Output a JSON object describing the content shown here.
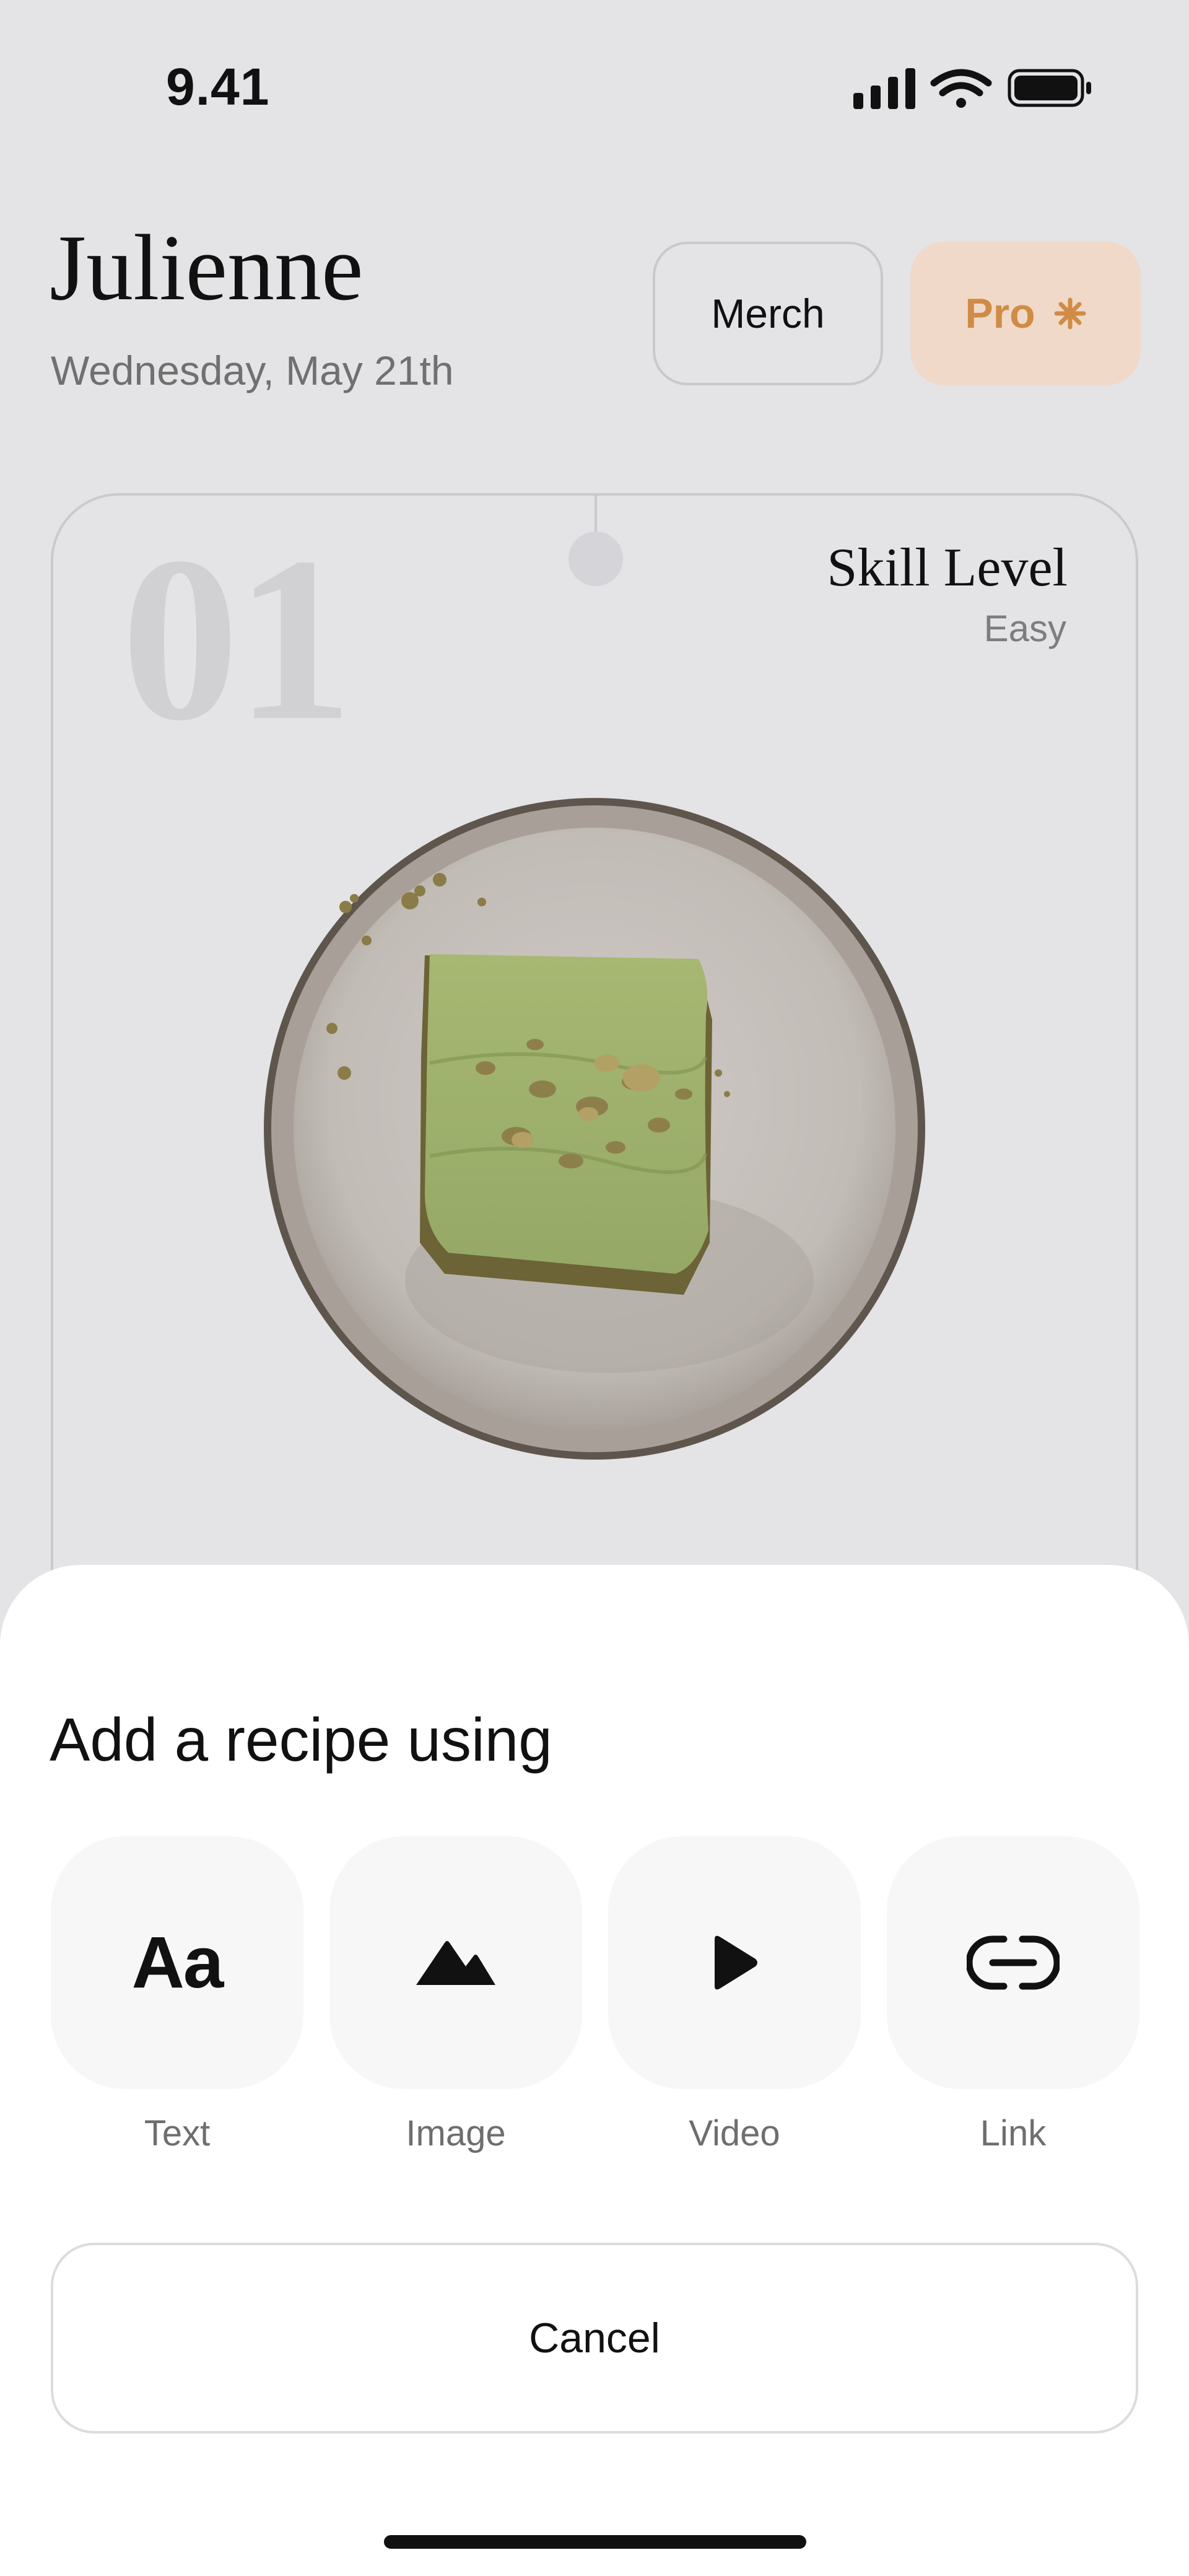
{
  "status_bar": {
    "time": "9.41"
  },
  "header": {
    "title": "Julienne",
    "date": "Wednesday, May 21th",
    "merch_label": "Merch",
    "pro_label": "Pro"
  },
  "card": {
    "number": "01",
    "skill_label": "Skill Level",
    "skill_value": "Easy",
    "image": "matcha-pistachio-bar-on-plate"
  },
  "sheet": {
    "title": "Add a recipe using",
    "options": [
      {
        "icon": "text-icon",
        "glyph": "Aa",
        "label": "Text"
      },
      {
        "icon": "image-icon",
        "label": "Image"
      },
      {
        "icon": "play-icon",
        "label": "Video"
      },
      {
        "icon": "link-icon",
        "label": "Link"
      }
    ],
    "cancel_label": "Cancel"
  },
  "colors": {
    "background": "#e4e3e6",
    "pro_bg": "#f0d9c8",
    "pro_text": "#d08c46",
    "sheet_bg": "#ffffff",
    "tile_bg": "#f7f7f8"
  }
}
